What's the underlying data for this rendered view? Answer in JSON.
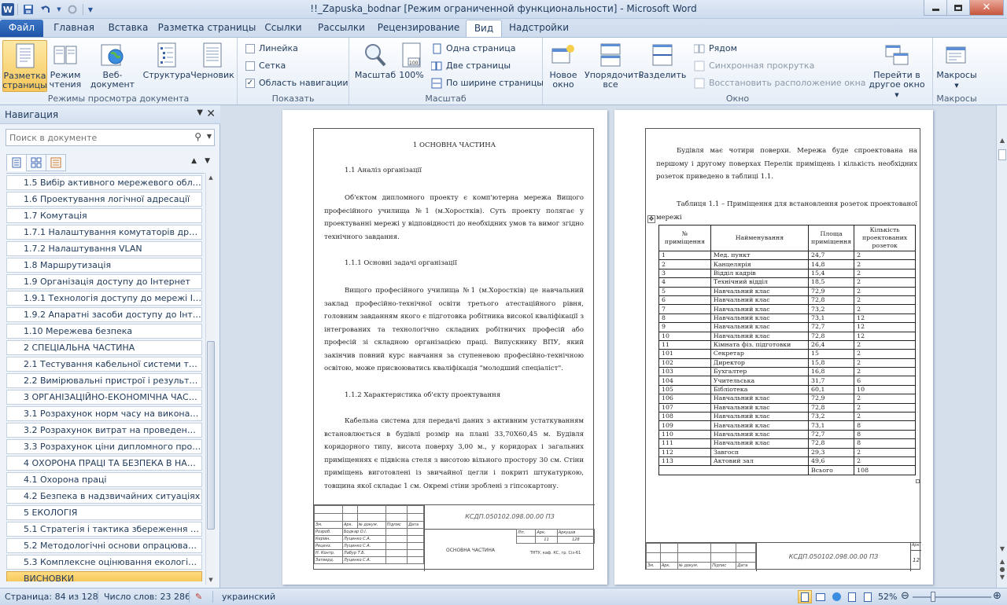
{
  "window": {
    "title": "!!_Zapuska_bodnar [Режим ограниченной функциональности]  -  Microsoft Word",
    "minimize_icon": "minimize-icon",
    "maximize_icon": "maximize-icon",
    "close_icon": "close-icon"
  },
  "quick_access": {
    "app_icon": "W",
    "save_icon": "save-icon",
    "undo_icon": "undo-icon",
    "redo_icon": "redo-icon"
  },
  "tabs": [
    {
      "label": "Файл"
    },
    {
      "label": "Главная"
    },
    {
      "label": "Вставка"
    },
    {
      "label": "Разметка страницы"
    },
    {
      "label": "Ссылки"
    },
    {
      "label": "Рассылки"
    },
    {
      "label": "Рецензирование"
    },
    {
      "label": "Вид"
    },
    {
      "label": "Надстройки"
    }
  ],
  "active_tab": "Вид",
  "ribbon": {
    "views": {
      "group_label": "Режимы просмотра документа",
      "buttons": [
        {
          "label": "Разметка страницы"
        },
        {
          "label": "Режим чтения"
        },
        {
          "label": "Веб-документ"
        },
        {
          "label": "Структура"
        },
        {
          "label": "Черновик"
        }
      ]
    },
    "show": {
      "group_label": "Показать",
      "ruler": "Линейка",
      "grid": "Сетка",
      "nav_pane": "Область навигации"
    },
    "zoom": {
      "group_label": "Масштаб",
      "zoom_btn": "Масштаб",
      "hundred": "100%",
      "one_page": "Одна страница",
      "two_pages": "Две страницы",
      "page_width": "По ширине страницы"
    },
    "window": {
      "group_label": "Окно",
      "new_window": "Новое окно",
      "arrange_all": "Упорядочить все",
      "split": "Разделить",
      "side_by_side": "Рядом",
      "sync_scroll": "Синхронная прокрутка",
      "reset_pos": "Восстановить расположение окна",
      "switch_windows": "Перейти в другое окно"
    },
    "macros": {
      "group_label": "Макросы",
      "macros_btn": "Макросы"
    }
  },
  "nav": {
    "title": "Навигация",
    "search_placeholder": "Поиск в документе",
    "items": [
      {
        "label": "1.5 Вибір активного мережевого облад..."
      },
      {
        "label": "1.6 Проектування логічної адресації"
      },
      {
        "label": "1.7 Комутація"
      },
      {
        "label": "1.7.1 Налаштування комутаторів другог..."
      },
      {
        "label": "1.7.2 Налаштування VLAN"
      },
      {
        "label": "1.8 Маршрутизація"
      },
      {
        "label": "1.9 Організація доступу до Інтернет"
      },
      {
        "label": "1.9.1 Технологія доступу до мережі Інте..."
      },
      {
        "label": "1.9.2 Апаратні засоби доступу до Інтернет"
      },
      {
        "label": "1.10 Мережева безпека"
      },
      {
        "label": "2 СПЕЦІАЛЬНА ЧАСТИНА"
      },
      {
        "label": "2.1 Тестування кабельної системи телек..."
      },
      {
        "label": "2.2 Вимірювальні пристрої і результати ..."
      },
      {
        "label": "3 ОРГАНІЗАЦІЙНО-ЕКОНОМІЧНА ЧАСТИ..."
      },
      {
        "label": "3.1 Розрахунок норм часу на виконання..."
      },
      {
        "label": "3.2 Розрахунок витрат на проведення д..."
      },
      {
        "label": "3.3 Розрахунок ціни дипломного проек..."
      },
      {
        "label": "4 ОХОРОНА ПРАЦІ ТА БЕЗПЕКА В НАДЗВ..."
      },
      {
        "label": "4.1 Охорона праці"
      },
      {
        "label": "4.2 Безпека в надзвичайних ситуаціях"
      },
      {
        "label": "5 ЕКОЛОГІЯ"
      },
      {
        "label": "5.1 Стратегія і тактика збереження й ро..."
      },
      {
        "label": "5.2 Методологічні основи опрацювання..."
      },
      {
        "label": "5.3 Комплексне оцінювання екологічно..."
      },
      {
        "label": "ВИСНОВКИ"
      }
    ],
    "selected": "ВИСНОВКИ"
  },
  "page1": {
    "heading": "1   ОСНОВНА ЧАСТИНА",
    "sub1": "1.1 Аналіз організації",
    "p1": "Об'єктом дипломного проекту є комп'ютерна мережа Вищого професійного училища №1 (м.Хоростків). Суть проекту полягає у проектуванні мережі у відповідності до необхідних умов та вимог згідно технічного завдання.",
    "sub2": "1.1.1  Основні задачі організації",
    "p2": "Вищого професійного училища №1 (м.Хоростків) це навчальний заклад професійно-технічної освіти третього атестаційного рівня, головним завданням якого є підготовка робітника високої кваліфікації з інтегрованих та технологічно складних робітничих професій або професій зі складною організацією праці. Випускнику ВПУ, який закінчив повний курс навчання за ступеневою професійно-технічною освітою, може присвоюватись кваліфікація \"молодший спеціаліст\".",
    "sub3": "1.1.2  Характеристика об'єкту проектування",
    "p3": "Кабельна система для передачі даних з активним устаткуванням встановлюється в будівлі розмір на плані 33,70Х60,45 м. Будівля коридорного типу, висота поверху 3,00 м., у коридорах і загальних приміщеннях є підвісна стеля з висотою вільного простору 30 см. Стіни приміщень виготовлені із звичайної цегли і покриті штукатуркою, товщина якої складає 1 см. Окремі стіни зроблені з гіпсокартону.",
    "stamp": {
      "code": "КСДП.050102.098.00.00  ПЗ",
      "title": "ОСНОВНА ЧАСТИНА",
      "org": "ТНТУ, каф. КС, гр. Сіз-61",
      "hdr": [
        "Зм.",
        "Арк.",
        "№ докум.",
        "Підпис",
        "Дата"
      ],
      "rows": [
        [
          "Розроб.",
          "Бодкар О.І."
        ],
        [
          "Керівн.",
          "Луценко С.А."
        ],
        [
          "Реценз.",
          "Луценко С.А."
        ],
        [
          "Н. Контр.",
          "Лабур Т.Б."
        ],
        [
          "Затверд.",
          "Луценко С.А."
        ]
      ],
      "lit": "Літ.",
      "ark": "Арк.",
      "arkushiv": "Аркушів",
      "ark_num": "11",
      "arkushiv_num": "128"
    }
  },
  "page2": {
    "p1": "Будівля має чотири поверхи. Мережа буде спроектована на першому і другому поверхах Перелік приміщень і кількість необхідних розеток приведено в таблиці 1.1.",
    "caption": "Таблиця 1.1 – Приміщення для встановлення розеток проектованої мережі",
    "table": {
      "headers": [
        "№ приміщення",
        "Найменування",
        "Площа приміщення",
        "Кількість проектованих розеток"
      ],
      "rows": [
        [
          "1",
          "Мед. пункт",
          "24,7",
          "2"
        ],
        [
          "2",
          "Канцелярія",
          "14,8",
          "2"
        ],
        [
          "3",
          "Відділ кадрів",
          "15,4",
          "2"
        ],
        [
          "4",
          "Технічний відділ",
          "18,5",
          "2"
        ],
        [
          "5",
          "Навчальний клас",
          "72,9",
          "2"
        ],
        [
          "6",
          "Навчальний клас",
          "72,8",
          "2"
        ],
        [
          "7",
          "Навчальний клас",
          "73,2",
          "2"
        ],
        [
          "8",
          "Навчальний клас",
          "73,1",
          "12"
        ],
        [
          "9",
          "Навчальний клас",
          "72,7",
          "12"
        ],
        [
          "10",
          "Навчальний клас",
          "72,8",
          "12"
        ],
        [
          "11",
          "Кімната фіз. підготовки",
          "26,4",
          "2"
        ],
        [
          "101",
          "Секретар",
          "15",
          "2"
        ],
        [
          "102",
          "Директор",
          "15,8",
          "2"
        ],
        [
          "103",
          "Бухгалтер",
          "16,8",
          "2"
        ],
        [
          "104",
          "Учительська",
          "31,7",
          "6"
        ],
        [
          "105",
          "Бібліотека",
          "60,1",
          "10"
        ],
        [
          "106",
          "Навчальний клас",
          "72,9",
          "2"
        ],
        [
          "107",
          "Навчальний клас",
          "72,8",
          "2"
        ],
        [
          "108",
          "Навчальний клас",
          "73,2",
          "2"
        ],
        [
          "109",
          "Навчальний клас",
          "73,1",
          "8"
        ],
        [
          "110",
          "Навчальний клас",
          "72,7",
          "8"
        ],
        [
          "111",
          "Навчальний клас",
          "72,8",
          "8"
        ],
        [
          "112",
          "Завгосп",
          "29,3",
          "2"
        ],
        [
          "113",
          "Актовий зал",
          "49,6",
          "2"
        ]
      ],
      "total_label": "Всього",
      "total_value": "108"
    },
    "stamp": {
      "code": "КСДП.050102.098.00.00  ПЗ",
      "ark": "Арк.",
      "page_num": "12",
      "hdr": [
        "Зм.",
        "Арк.",
        "№ докум.",
        "Підпис",
        "Дата"
      ]
    }
  },
  "status": {
    "page": "Страница: 84 из 128",
    "words": "Число слов: 23 286",
    "lang": "украинский",
    "zoom": "52%"
  }
}
